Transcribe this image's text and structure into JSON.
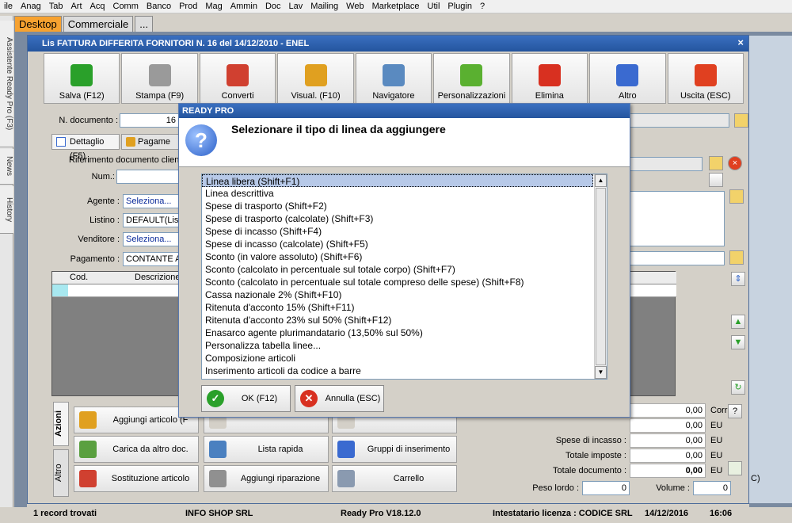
{
  "menu": [
    "ile",
    "Anag",
    "Tab",
    "Art",
    "Acq",
    "Comm",
    "Banco",
    "Prod",
    "Mag",
    "Ammin",
    "Doc",
    "Lav",
    "Mailing",
    "Web",
    "Marketplace",
    "Util",
    "Plugin",
    "?"
  ],
  "tabs": [
    "Desktop",
    "Commerciale",
    "..."
  ],
  "side_tabs": [
    "Assistente Ready Pro (F3)",
    "News",
    "History"
  ],
  "invoice": {
    "title": "Lis FATTURA DIFFERITA FORNITORI N. 16 del 14/12/2010 - ENEL",
    "close": "×",
    "toolbar": [
      {
        "label": "Salva (F12)",
        "icon": "check-icon",
        "color": "#2aa02a"
      },
      {
        "label": "Stampa (F9)",
        "icon": "printer-icon",
        "color": "#9a9a9a"
      },
      {
        "label": "Converti",
        "icon": "convert-icon",
        "color": "#d04030"
      },
      {
        "label": "Visual. (F10)",
        "icon": "magic-wand-icon",
        "color": "#e0a020"
      },
      {
        "label": "Navigatore",
        "icon": "compass-icon",
        "color": "#5a8ac0"
      },
      {
        "label": "Personalizzazioni",
        "icon": "puzzle-icon",
        "color": "#5ab030"
      },
      {
        "label": "Elimina",
        "icon": "delete-x-icon",
        "color": "#d83020"
      },
      {
        "label": "Altro",
        "icon": "search-book-icon",
        "color": "#3a6ad0"
      },
      {
        "label": "Uscita (ESC)",
        "icon": "exit-icon",
        "color": "#e04020"
      }
    ],
    "n_documento_label": "N. documento :",
    "n_documento_value": "16",
    "subtabs": [
      "Dettaglio (F5)",
      "Pagame"
    ],
    "riferimento_label": "Riferimento documento clien",
    "num_label": "Num.:",
    "agente_label": "Agente :",
    "agente_value": "Seleziona...",
    "listino_label": "Listino :",
    "listino_value": "DEFAULT(Listi",
    "venditore_label": "Venditore :",
    "venditore_value": "Seleziona...",
    "pagamento_label": "Pagamento :",
    "pagamento_value": "CONTANTE AL",
    "grid_cols": [
      "Cod.",
      "Descrizione"
    ],
    "actions_tabs": [
      "Azioni",
      "Altro"
    ],
    "actions": [
      {
        "label": "Aggiungi articolo (F",
        "icon": "add-article-icon",
        "color": "#e0a020"
      },
      {
        "label": "",
        "icon": "blank-icon",
        "color": "#d4d0c8"
      },
      {
        "label": "",
        "icon": "blank-icon",
        "color": "#d4d0c8"
      },
      {
        "label": "Carica da altro doc.",
        "icon": "load-doc-icon",
        "color": "#5aa040"
      },
      {
        "label": "Lista rapida",
        "icon": "quick-list-icon",
        "color": "#4a80c0"
      },
      {
        "label": "Gruppi di inserimento",
        "icon": "group-insert-icon",
        "color": "#3a6ad0"
      },
      {
        "label": "Sostituzione articolo",
        "icon": "replace-icon",
        "color": "#d04030"
      },
      {
        "label": "Aggiungi riparazione",
        "icon": "wrench-icon",
        "color": "#909090"
      },
      {
        "label": "Carrello",
        "icon": "cart-icon",
        "color": "#8a9ab0"
      }
    ],
    "totals": [
      {
        "label": "",
        "value": "0,00",
        "unit": "Corrisp."
      },
      {
        "label": "",
        "value": "0,00",
        "unit": "EU"
      },
      {
        "label": "Spese di incasso :",
        "value": "0,00",
        "unit": "EU"
      },
      {
        "label": "Totale imposte :",
        "value": "0,00",
        "unit": "EU"
      },
      {
        "label": "Totale documento :",
        "value": "0,00",
        "unit": "EU"
      }
    ],
    "peso_label": "Peso lordo :",
    "peso_value": "0",
    "volume_label": "Volume :",
    "volume_value": "0",
    "question_btn": "?",
    "esc_fragment": "C)"
  },
  "statusbar": {
    "records": "1 record trovati",
    "company": "INFO SHOP SRL",
    "version": "Ready Pro V18.12.0",
    "license": "Intestatario licenza : CODICE SRL",
    "date": "14/12/2016",
    "time": "16:06"
  },
  "dialog": {
    "title": "READY PRO",
    "message": "Selezionare il tipo di linea da aggiungere",
    "items": [
      "Linea libera (Shift+F1)",
      "Linea descrittiva",
      "Spese di trasporto (Shift+F2)",
      "Spese di trasporto (calcolate) (Shift+F3)",
      "Spese di incasso (Shift+F4)",
      "Spese di incasso (calcolate) (Shift+F5)",
      "Sconto (in valore assoluto) (Shift+F6)",
      "Sconto (calcolato in percentuale sul totale corpo) (Shift+F7)",
      "Sconto (calcolato in percentuale sul totale compreso delle spese) (Shift+F8)",
      "Cassa nazionale 2% (Shift+F10)",
      "Ritenuta d'acconto 15% (Shift+F11)",
      "Ritenuta d'acconto 23% sul 50% (Shift+F12)",
      "Enasarco agente plurimandatario (13,50% sul 50%)",
      "Personalizza tabella linee...",
      "Composizione articoli",
      "Inserimento articoli da codice a barre"
    ],
    "selected_index": 0,
    "ok_label": "OK (F12)",
    "cancel_label": "Annulla (ESC)"
  }
}
